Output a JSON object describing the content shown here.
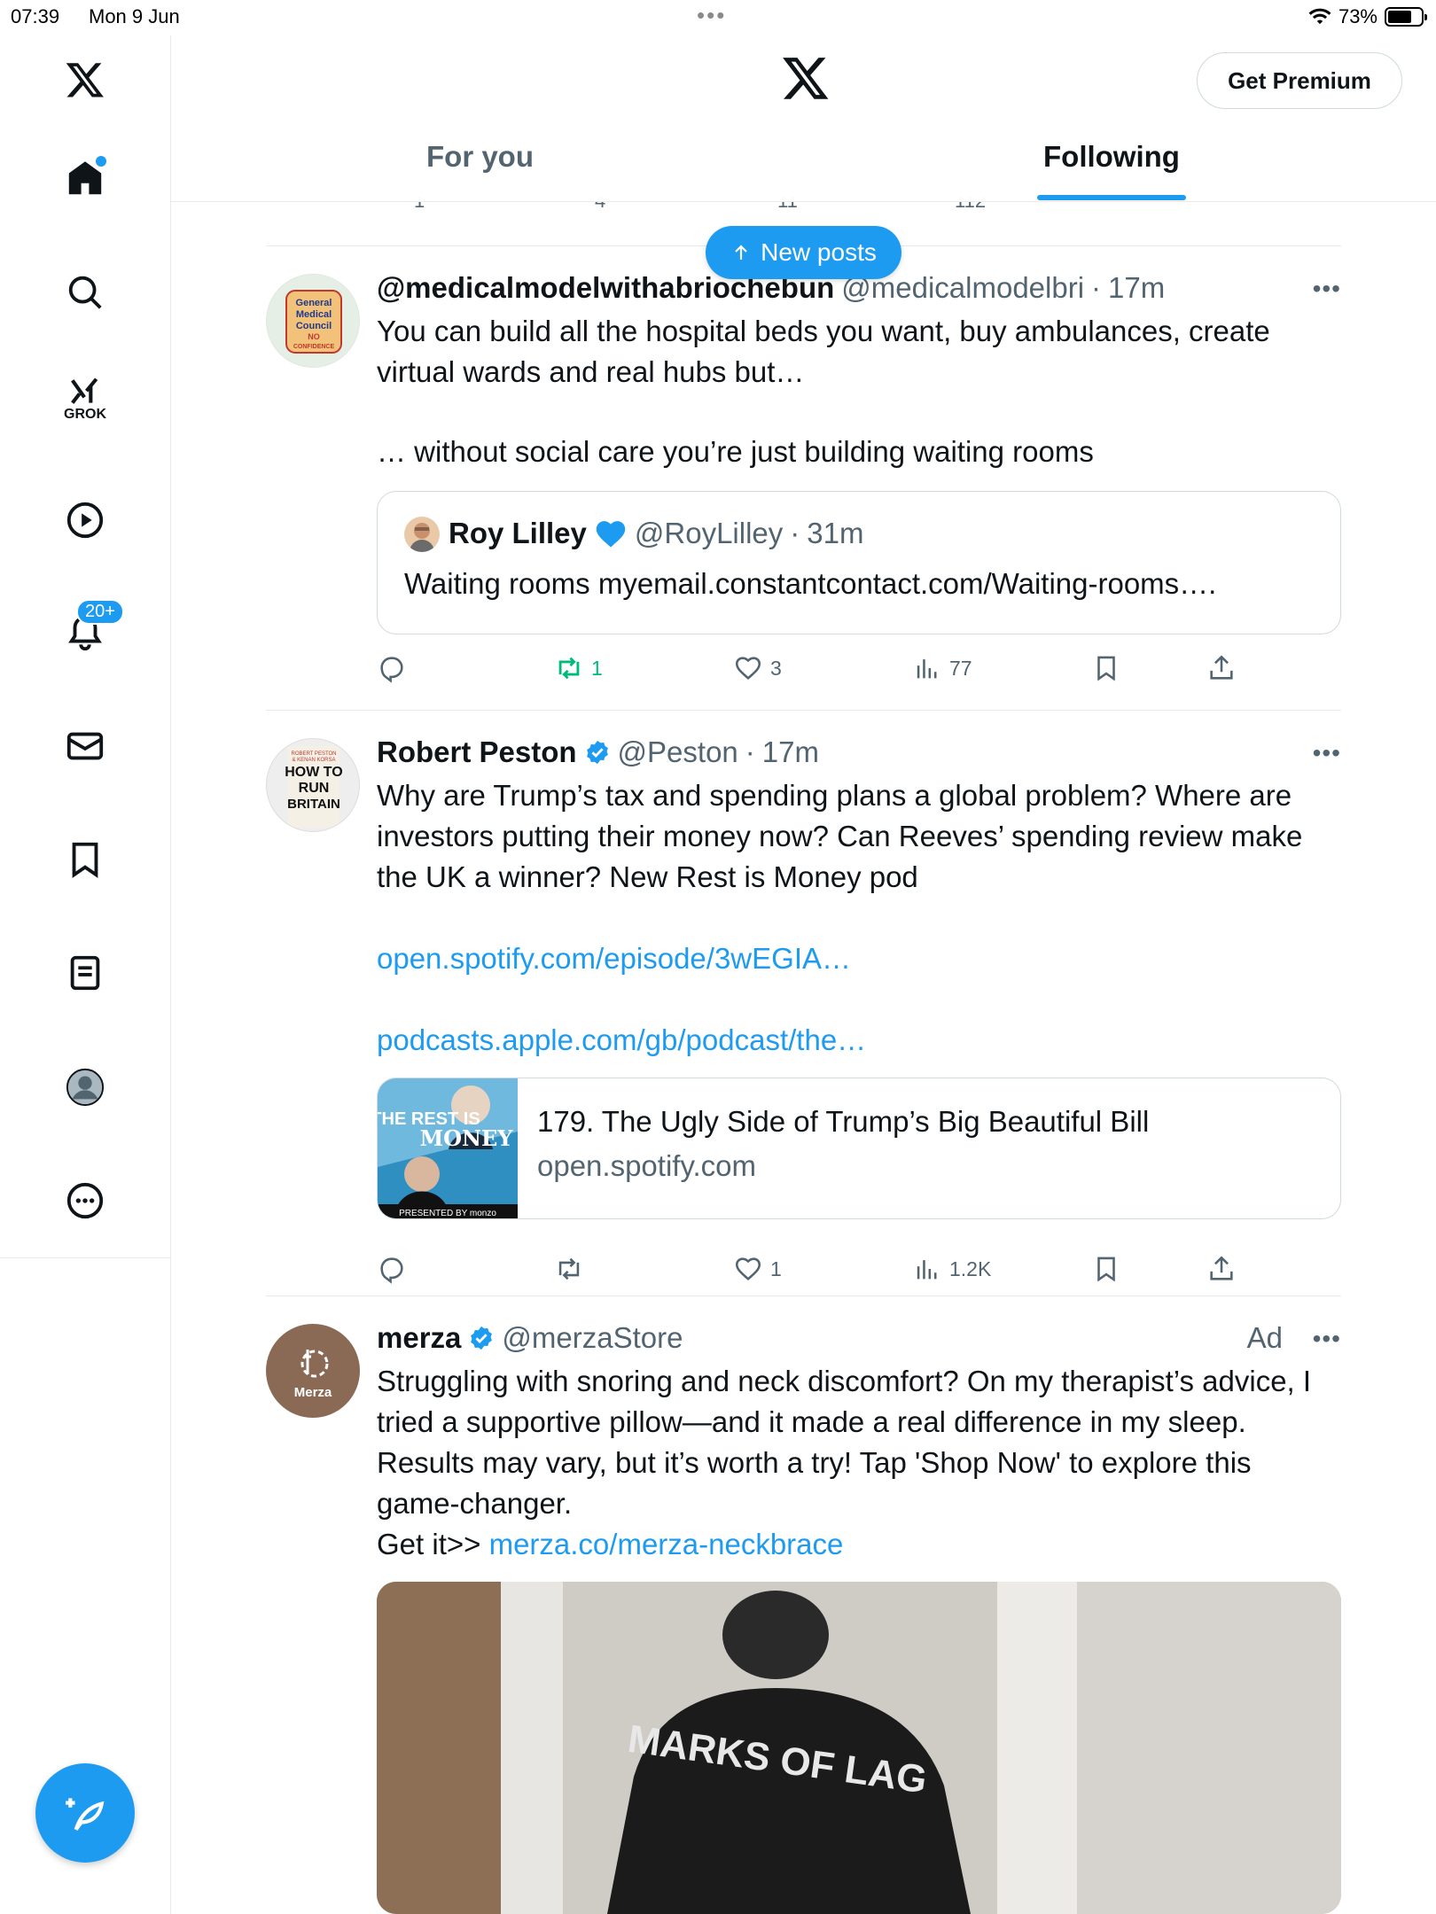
{
  "status": {
    "time": "07:39",
    "date": "Mon 9 Jun",
    "battery": "73%"
  },
  "header": {
    "premium_label": "Get Premium",
    "tabs": [
      {
        "label": "For you"
      },
      {
        "label": "Following"
      }
    ]
  },
  "sidebar": {
    "grok_label": "GROK",
    "notif_badge": "20+"
  },
  "new_posts_label": "New posts",
  "prev_actions": {
    "replies": "1",
    "reposts": "4",
    "likes": "11",
    "views": "112"
  },
  "posts": [
    {
      "name": "@medicalmodelwithabriochebun",
      "handle": "@medicalmodelbri",
      "time": "17m",
      "text1": "You can build all the hospital beds you want, buy ambulances, create virtual wards and real hubs but…",
      "text2": "… without social care you’re just building waiting rooms",
      "quote": {
        "name": "Roy Lilley",
        "handle": "@RoyLilley",
        "time": "31m",
        "text": "Waiting rooms myemail.constantcontact.com/Waiting-rooms…."
      },
      "avatar_text": [
        "General",
        "Medical",
        "Council",
        "NO",
        "CONFIDENCE"
      ],
      "actions": {
        "replies": "",
        "reposts": "1",
        "likes": "3",
        "views": "77"
      }
    },
    {
      "name": "Robert Peston",
      "handle": "@Peston",
      "time": "17m",
      "text1": "Why are Trump’s tax and spending plans a global problem? Where are investors putting their money now? Can Reeves’ spending review make the UK a winner? New Rest is Money pod",
      "link1": "open.spotify.com/episode/3wEGIA…",
      "link2": "podcasts.apple.com/gb/podcast/the…",
      "avatar_text": [
        "ROBERT PESTON",
        "& KENAN KORSA",
        "HOW TO",
        "RUN",
        "BRITAIN"
      ],
      "card": {
        "title": "179. The Ugly Side of Trump’s Big Beautiful Bill",
        "domain": "open.spotify.com",
        "thumb_title1": "THE REST IS",
        "thumb_title2": "MONEY",
        "thumb_footer": "PRESENTED BY monzo"
      },
      "actions": {
        "replies": "",
        "reposts": "",
        "likes": "1",
        "views": "1.2K"
      }
    },
    {
      "name": "merza",
      "handle": "@merzaStore",
      "ad_label": "Ad",
      "text1": "Struggling with snoring and neck discomfort? On my therapist’s advice, I tried a supportive pillow—and it made a real difference in my sleep. Results may vary, but it’s worth a try! Tap 'Shop Now' to explore this game-changer.",
      "text_prefix": "Get it>> ",
      "link1": "merza.co/merza-neckbrace",
      "avatar_text": "Merza",
      "media_text": "MARKS OF LAG"
    }
  ],
  "colors": {
    "accent": "#1d9bf0",
    "repost_active": "#00ba7c",
    "muted": "#536471"
  }
}
